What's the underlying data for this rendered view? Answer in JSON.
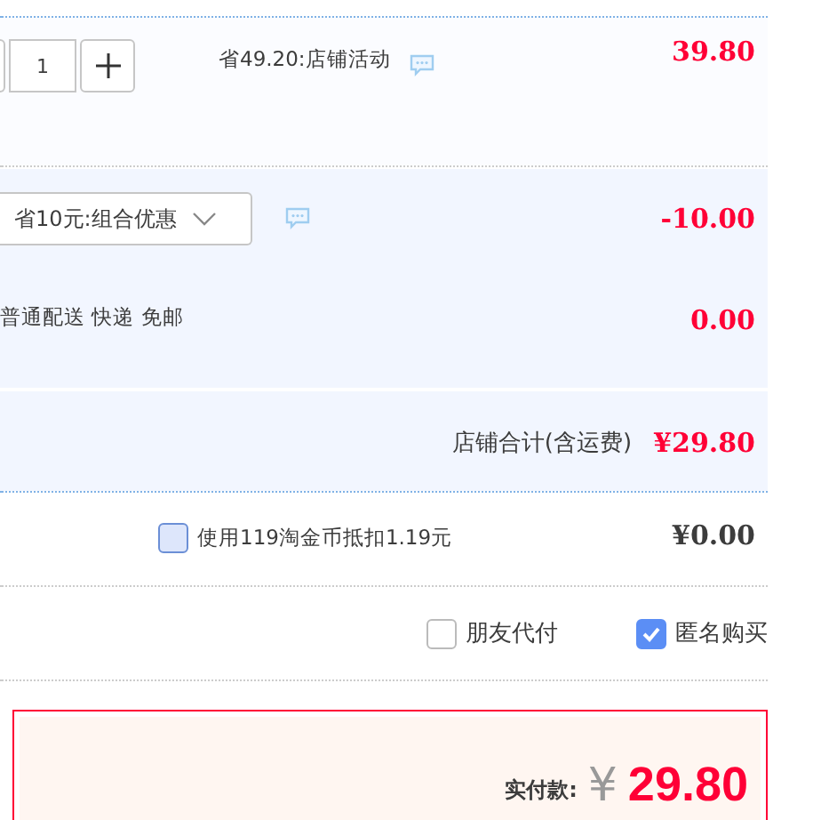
{
  "product_row": {
    "quantity": "1",
    "discount_note": "省49.20:店铺活动",
    "price": "39.80"
  },
  "combo_row": {
    "promotion": "省10元:组合优惠",
    "amount": "-10.00"
  },
  "shipping_row": {
    "method": "普通配送 快递 免邮",
    "amount": "0.00"
  },
  "store_total": {
    "label": "店铺合计(含运费)",
    "amount": "¥29.80"
  },
  "coins": {
    "label": "使用119淘金币抵扣1.19元",
    "checked": false,
    "amount": "¥0.00"
  },
  "options": [
    {
      "label": "朋友代付",
      "checked": false
    },
    {
      "label": "匿名购买",
      "checked": true
    }
  ],
  "payment": {
    "label": "实付款:",
    "currency": "¥",
    "amount": "29.80"
  }
}
